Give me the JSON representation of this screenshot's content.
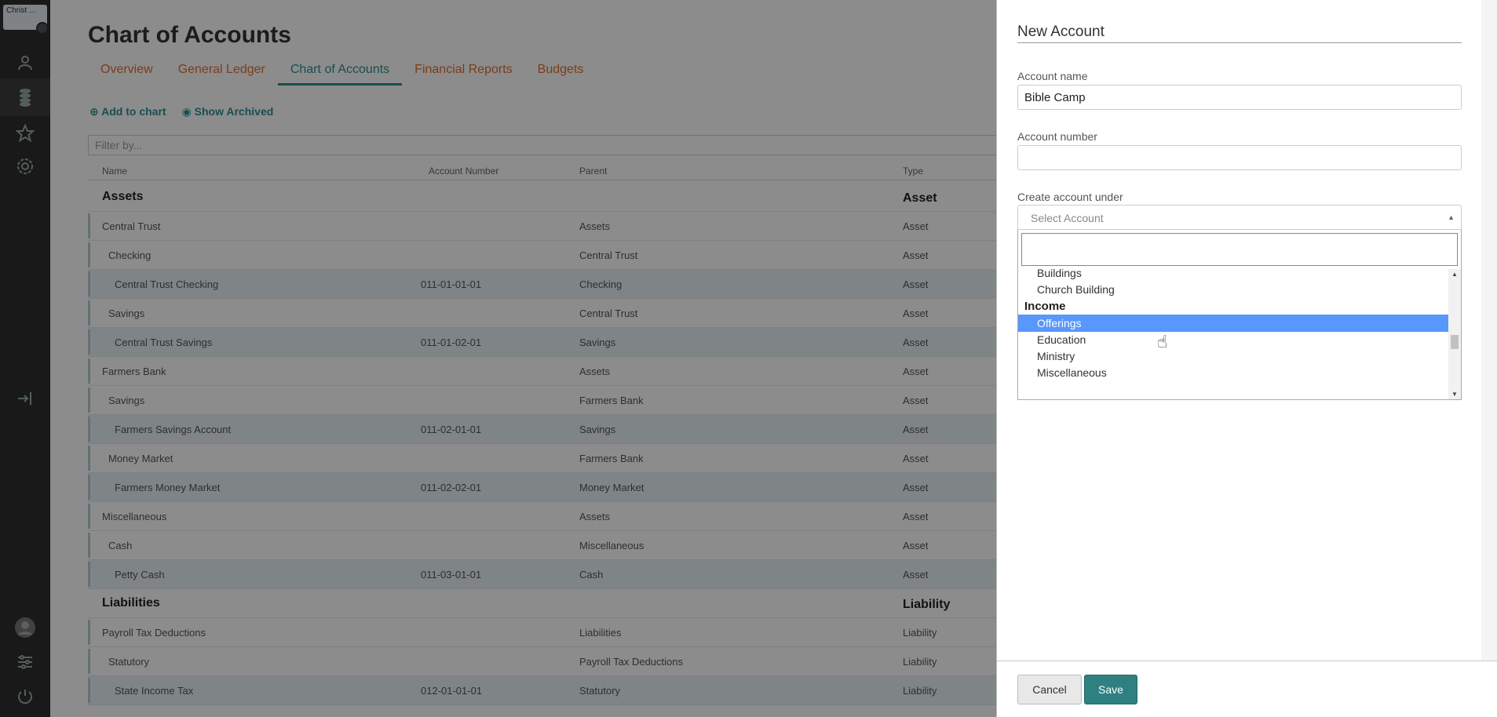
{
  "sidebar": {
    "logo_text": "Christ ...",
    "icons": [
      "person-icon",
      "coins-icon",
      "star-icon",
      "gear-icon",
      "sign-in-icon",
      "avatar-icon",
      "sliders-icon",
      "power-icon"
    ]
  },
  "main": {
    "title": "Chart of Accounts",
    "tabs": [
      {
        "label": "Overview"
      },
      {
        "label": "General Ledger"
      },
      {
        "label": "Chart of Accounts",
        "active": true
      },
      {
        "label": "Financial Reports"
      },
      {
        "label": "Budgets"
      }
    ],
    "actions": {
      "add": "Add to chart",
      "archived": "Show Archived"
    },
    "filter_placeholder": "Filter by...",
    "columns": {
      "name": "Name",
      "number": "Account Number",
      "parent": "Parent",
      "type": "Type"
    },
    "rows": [
      {
        "name": "Assets",
        "number": "",
        "parent": "",
        "type": "Asset",
        "level": 0,
        "section": true
      },
      {
        "name": "Central Trust",
        "number": "",
        "parent": "Assets",
        "type": "Asset",
        "level": 1
      },
      {
        "name": "Checking",
        "number": "",
        "parent": "Central Trust",
        "type": "Asset",
        "level": 2
      },
      {
        "name": "Central Trust Checking",
        "number": "011-01-01-01",
        "parent": "Checking",
        "type": "Asset",
        "level": 3
      },
      {
        "name": "Savings",
        "number": "",
        "parent": "Central Trust",
        "type": "Asset",
        "level": 2
      },
      {
        "name": "Central Trust Savings",
        "number": "011-01-02-01",
        "parent": "Savings",
        "type": "Asset",
        "level": 3
      },
      {
        "name": "Farmers Bank",
        "number": "",
        "parent": "Assets",
        "type": "Asset",
        "level": 1
      },
      {
        "name": "Savings",
        "number": "",
        "parent": "Farmers Bank",
        "type": "Asset",
        "level": 2
      },
      {
        "name": "Farmers Savings Account",
        "number": "011-02-01-01",
        "parent": "Savings",
        "type": "Asset",
        "level": 3
      },
      {
        "name": "Money Market",
        "number": "",
        "parent": "Farmers Bank",
        "type": "Asset",
        "level": 2
      },
      {
        "name": "Farmers Money Market",
        "number": "011-02-02-01",
        "parent": "Money Market",
        "type": "Asset",
        "level": 3
      },
      {
        "name": "Miscellaneous",
        "number": "",
        "parent": "Assets",
        "type": "Asset",
        "level": 1
      },
      {
        "name": "Cash",
        "number": "",
        "parent": "Miscellaneous",
        "type": "Asset",
        "level": 2
      },
      {
        "name": "Petty Cash",
        "number": "011-03-01-01",
        "parent": "Cash",
        "type": "Asset",
        "level": 3
      },
      {
        "name": "Liabilities",
        "number": "",
        "parent": "",
        "type": "Liability",
        "level": 0,
        "section": true
      },
      {
        "name": "Payroll Tax Deductions",
        "number": "",
        "parent": "Liabilities",
        "type": "Liability",
        "level": 1
      },
      {
        "name": "Statutory",
        "number": "",
        "parent": "Payroll Tax Deductions",
        "type": "Liability",
        "level": 2
      },
      {
        "name": "State Income Tax",
        "number": "012-01-01-01",
        "parent": "Statutory",
        "type": "Liability",
        "level": 3
      }
    ]
  },
  "panel": {
    "title": "New Account",
    "account_name_label": "Account name",
    "account_name_value": "Bible Camp",
    "account_number_label": "Account number",
    "account_number_value": "",
    "create_under_label": "Create account under",
    "select_placeholder": "Select Account",
    "options": [
      {
        "label": "Buildings",
        "group": false
      },
      {
        "label": "Church Building",
        "group": false
      },
      {
        "label": "Income",
        "group": true
      },
      {
        "label": "Offerings",
        "group": false,
        "highlighted": true
      },
      {
        "label": "Education",
        "group": false
      },
      {
        "label": "Ministry",
        "group": false
      },
      {
        "label": "Miscellaneous",
        "group": false
      }
    ],
    "cancel_label": "Cancel",
    "save_label": "Save"
  }
}
